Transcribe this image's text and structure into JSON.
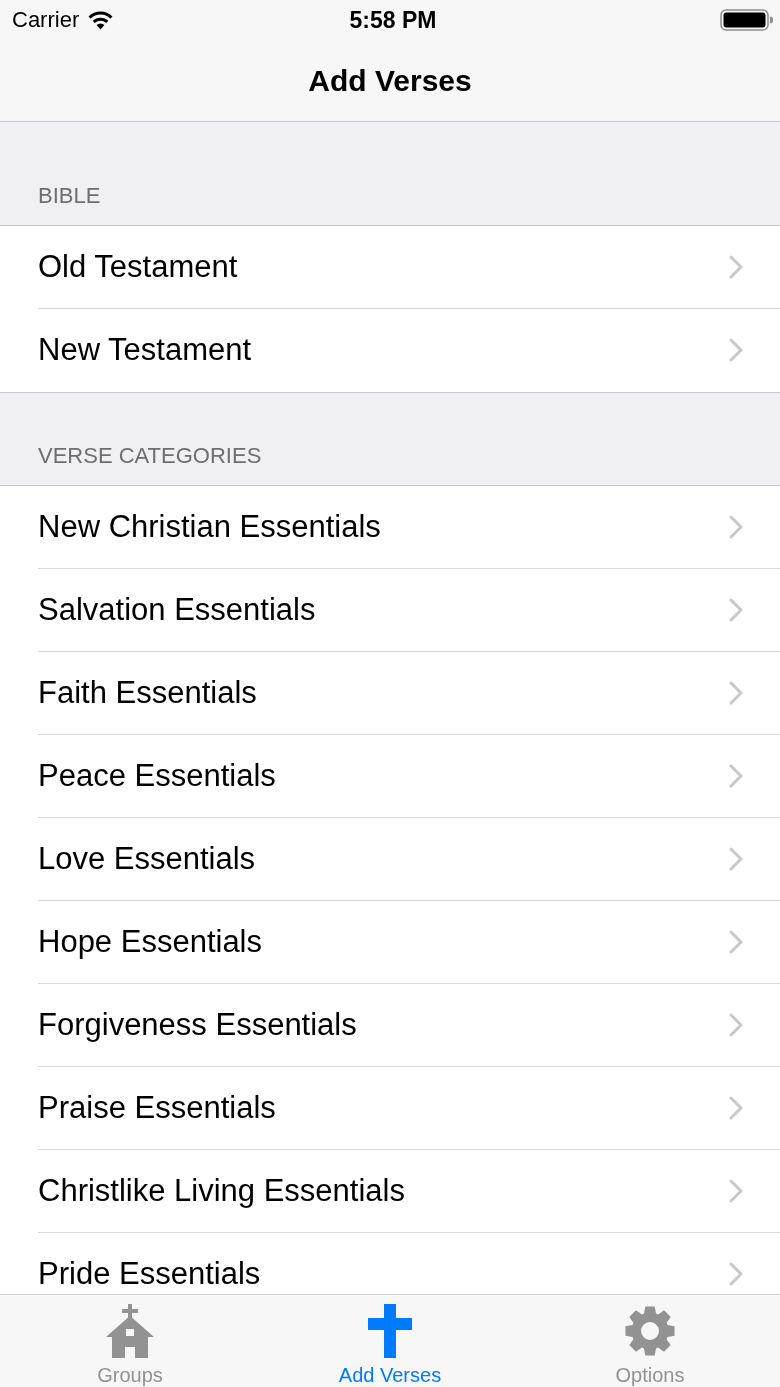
{
  "status_bar": {
    "carrier": "Carrier",
    "time": "5:58 PM"
  },
  "nav_bar": {
    "title": "Add Verses"
  },
  "sections": [
    {
      "header": "BIBLE",
      "items": [
        {
          "label": "Old Testament"
        },
        {
          "label": "New Testament"
        }
      ]
    },
    {
      "header": "VERSE CATEGORIES",
      "items": [
        {
          "label": "New Christian Essentials"
        },
        {
          "label": "Salvation Essentials"
        },
        {
          "label": "Faith Essentials"
        },
        {
          "label": "Peace Essentials"
        },
        {
          "label": "Love Essentials"
        },
        {
          "label": "Hope Essentials"
        },
        {
          "label": "Forgiveness Essentials"
        },
        {
          "label": "Praise Essentials"
        },
        {
          "label": "Christlike Living Essentials"
        },
        {
          "label": "Pride Essentials"
        }
      ]
    }
  ],
  "tab_bar": {
    "tabs": [
      {
        "label": "Groups",
        "selected": false
      },
      {
        "label": "Add Verses",
        "selected": true
      },
      {
        "label": "Options",
        "selected": false
      }
    ]
  }
}
